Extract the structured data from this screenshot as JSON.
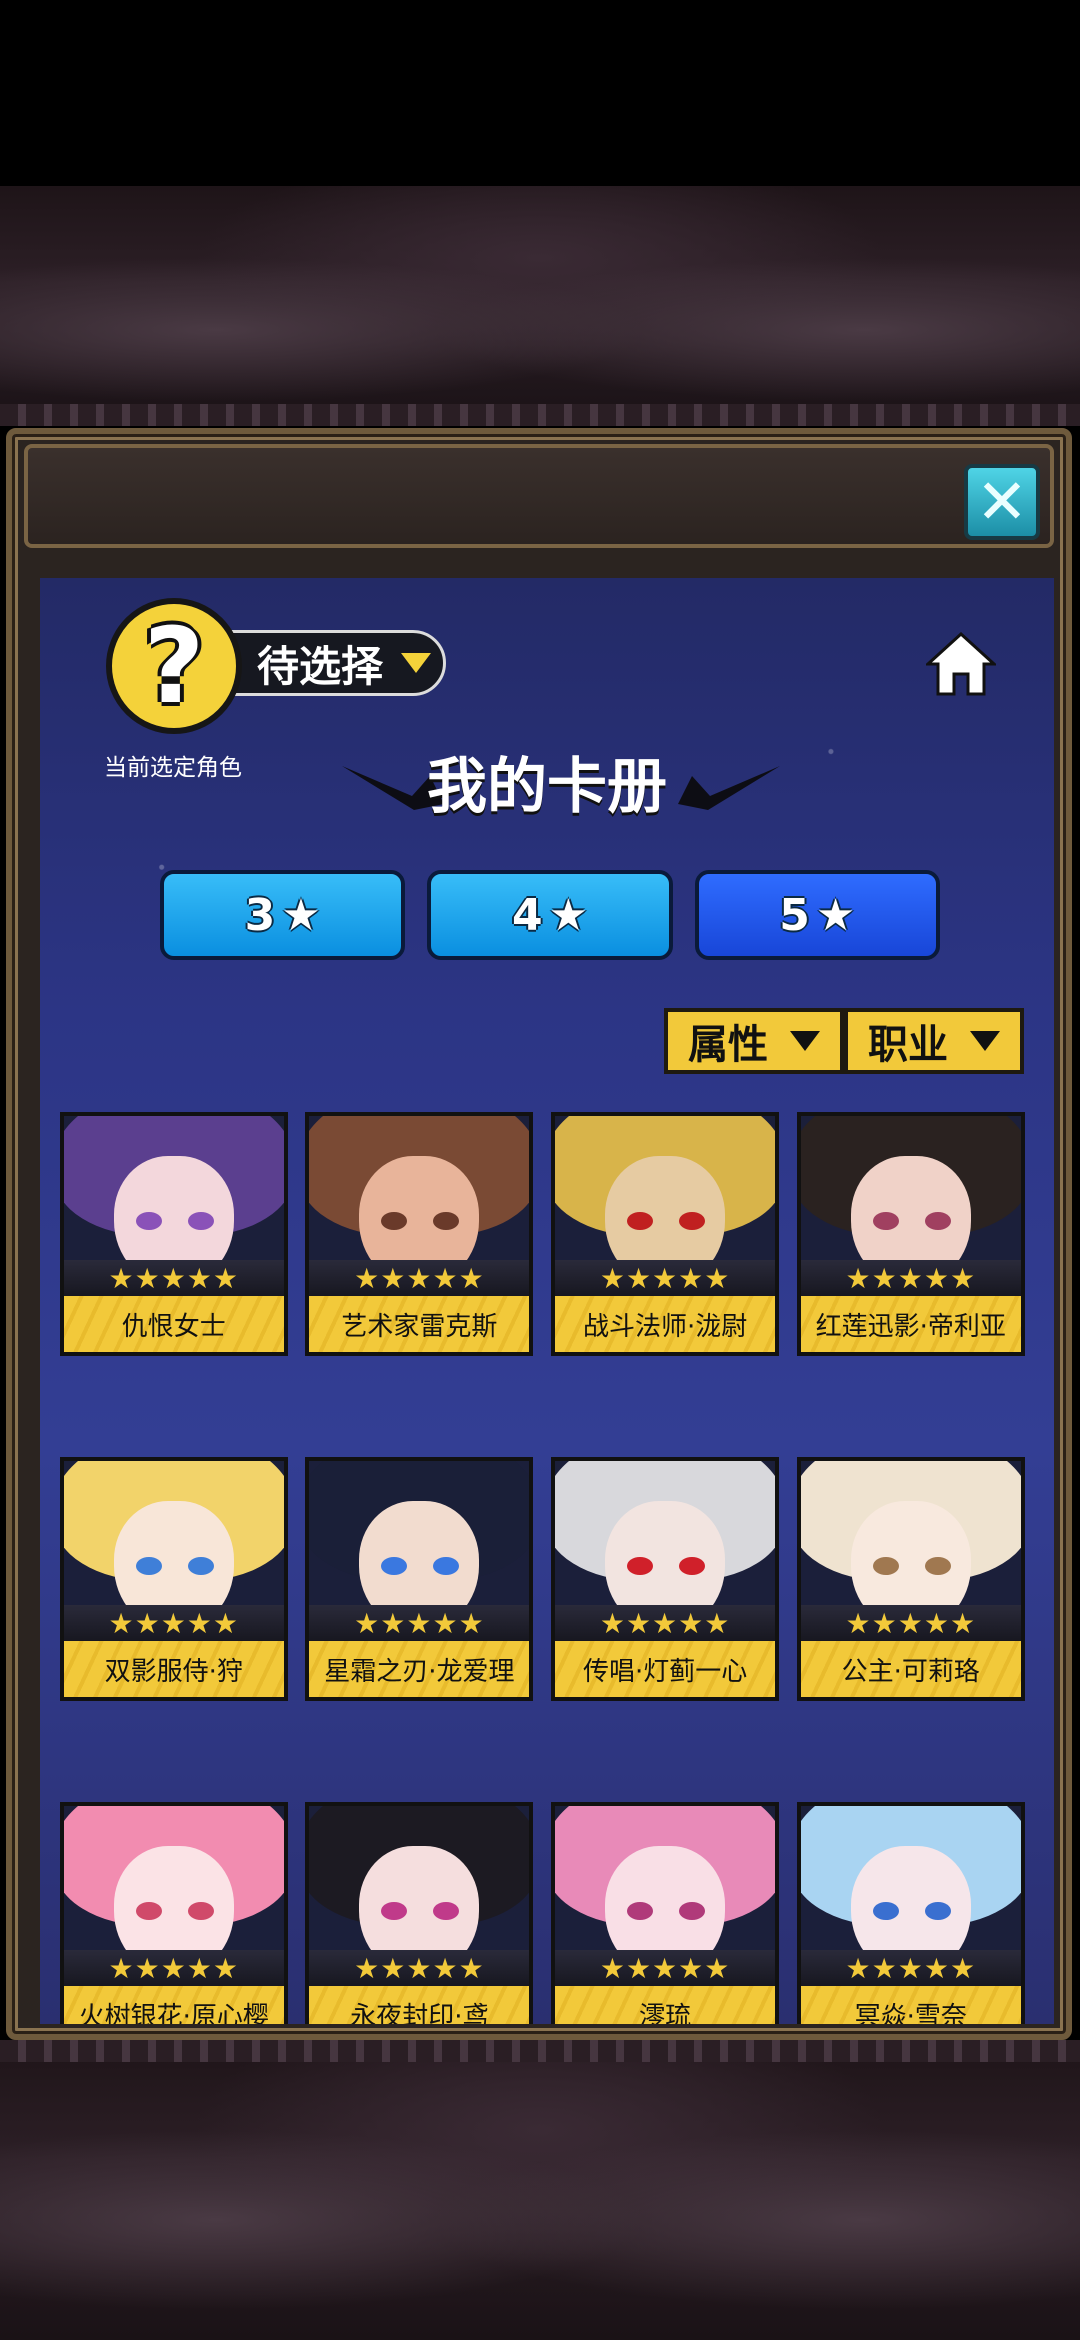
{
  "header": {
    "selected_label": "待选择",
    "current_role_label": "当前选定角色",
    "avatar_placeholder": "?",
    "page_title": "我的卡册"
  },
  "tabs": [
    {
      "label": "3",
      "icon": "star-icon",
      "active": false
    },
    {
      "label": "4",
      "icon": "star-icon",
      "active": false
    },
    {
      "label": "5",
      "icon": "star-icon",
      "active": true
    }
  ],
  "filters": {
    "attribute_label": "属性",
    "class_label": "职业"
  },
  "cards": [
    {
      "name": "仇恨女士",
      "stars": "★★★★★",
      "hair": "#5b3f8f",
      "skin": "#f3d7dc",
      "eye": "#8a52b8"
    },
    {
      "name": "艺术家雷克斯",
      "stars": "★★★★★",
      "hair": "#7a4a34",
      "skin": "#e8b49a",
      "eye": "#6a3a2a"
    },
    {
      "name": "战斗法师·泷尉",
      "stars": "★★★★★",
      "hair": "#d8b44a",
      "skin": "#e6cba2",
      "eye": "#c02020"
    },
    {
      "name": "红莲迅影·帝利亚",
      "stars": "★★★★★",
      "hair": "#2a2220",
      "skin": "#f0d2c8",
      "eye": "#a04060"
    },
    {
      "name": "双影服侍·狩",
      "stars": "★★★★★",
      "hair": "#f2d36a",
      "skin": "#f8e6d8",
      "eye": "#3f7fd8"
    },
    {
      "name": "星霜之刃·龙爱理",
      "stars": "★★★★★",
      "hair": "#1a1f38",
      "skin": "#f2dccf",
      "eye": "#3a78e0"
    },
    {
      "name": "传唱·灯蓟一心",
      "stars": "★★★★★",
      "hair": "#d8d8dc",
      "skin": "#f2e4e0",
      "eye": "#d0202a"
    },
    {
      "name": "公主·可莉珞",
      "stars": "★★★★★",
      "hair": "#efe3d0",
      "skin": "#f8e9de",
      "eye": "#a07850"
    },
    {
      "name": "火树银花·原心樱",
      "stars": "★★★★★",
      "hair": "#f28cb0",
      "skin": "#fbe3e6",
      "eye": "#d04a6a"
    },
    {
      "name": "永夜封印·鸢",
      "stars": "★★★★★",
      "hair": "#1c1a22",
      "skin": "#f5dede",
      "eye": "#c03a8a"
    },
    {
      "name": "澪琉",
      "stars": "★★★★★",
      "hair": "#e88ab8",
      "skin": "#f9dfe6",
      "eye": "#b03a7a"
    },
    {
      "name": "冥焱·雪奈",
      "stars": "★★★★★",
      "hair": "#a9d4f2",
      "skin": "#f6e6ea",
      "eye": "#3a6fd0"
    }
  ],
  "colors": {
    "accent_yellow": "#f2c93a",
    "tab_blue": "#0a8fe0",
    "tab_active": "#1846d8",
    "panel_bg": "#2c3585"
  }
}
